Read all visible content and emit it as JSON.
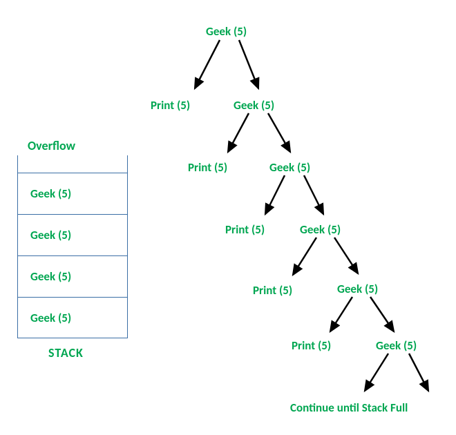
{
  "colors": {
    "text": "#00a651",
    "border": "#3a6ea5",
    "arrow": "#000000"
  },
  "tree": {
    "level0": {
      "root": "Geek (5)"
    },
    "level1": {
      "left": "Print (5)",
      "right": "Geek (5)"
    },
    "level2": {
      "left": "Print (5)",
      "right": "Geek (5)"
    },
    "level3": {
      "left": "Print (5)",
      "right": "Geek (5)"
    },
    "level4": {
      "left": "Print (5)",
      "right": "Geek (5)"
    },
    "level5": {
      "left": "Print (5)",
      "right": "Geek (5)"
    }
  },
  "footer": "Continue until Stack Full",
  "stack": {
    "overflow_label": "Overflow",
    "items": [
      "Geek (5)",
      "Geek (5)",
      "Geek (5)",
      "Geek (5)"
    ],
    "title": "STACK"
  }
}
